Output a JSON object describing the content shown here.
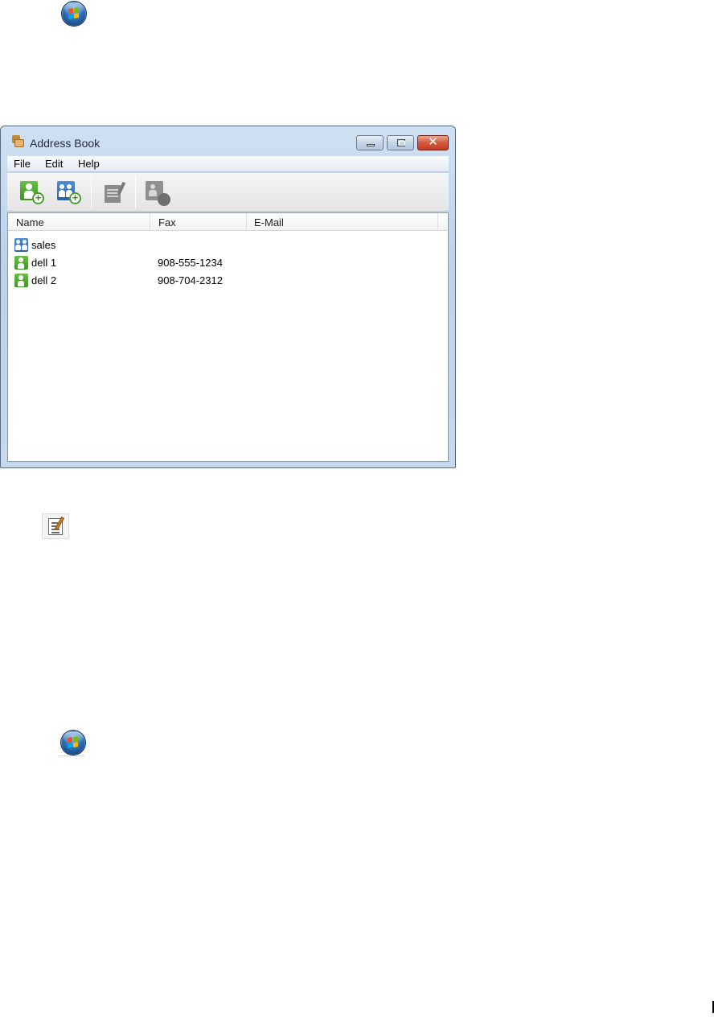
{
  "window": {
    "title": "Address Book",
    "caption_buttons": {
      "minimize": "minimize",
      "maximize": "maximize",
      "close": "✕"
    }
  },
  "menu": {
    "items": [
      {
        "label": "File"
      },
      {
        "label": "Edit"
      },
      {
        "label": "Help"
      }
    ]
  },
  "toolbar": {
    "buttons": [
      {
        "name": "new-contact",
        "icon": "add-contact-icon"
      },
      {
        "name": "new-group",
        "icon": "add-group-icon"
      },
      {
        "name": "properties",
        "icon": "properties-icon"
      },
      {
        "name": "setup",
        "icon": "setup-icon"
      }
    ]
  },
  "list": {
    "columns": {
      "name": "Name",
      "fax": "Fax",
      "email": "E-Mail"
    },
    "rows": [
      {
        "type": "group",
        "name": "sales",
        "fax": "",
        "email": ""
      },
      {
        "type": "contact",
        "name": "dell 1",
        "fax": "908-555-1234",
        "email": ""
      },
      {
        "type": "contact",
        "name": "dell 2",
        "fax": "908-704-2312",
        "email": ""
      }
    ]
  },
  "icons": {
    "start_orb": "windows-start-icon",
    "properties_small": "properties-icon"
  },
  "colors": {
    "group_icon": "#2b5fa8",
    "contact_icon": "#3f9326",
    "close_button": "#c23b22"
  }
}
